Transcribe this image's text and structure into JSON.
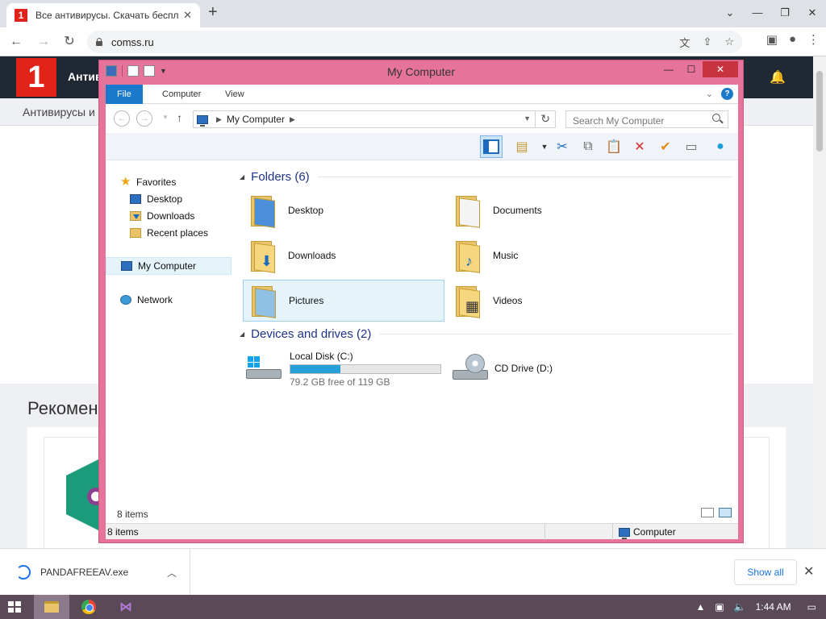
{
  "browser": {
    "tab_title": "Все антивирусы. Скачать бесплатно",
    "tab_favicon": "1",
    "url": "comss.ru"
  },
  "site": {
    "logo": "1",
    "menu_label": "Антив",
    "sub_label": "Антивирусы и",
    "heading": "Рекомен"
  },
  "explorer": {
    "window_title": "My Computer",
    "ribbon_tabs": [
      "File",
      "Computer",
      "View"
    ],
    "breadcrumb": "My Computer",
    "search_placeholder": "Search My Computer",
    "nav": {
      "favorites": "Favorites",
      "desktop": "Desktop",
      "downloads": "Downloads",
      "recent": "Recent places",
      "my_computer": "My Computer",
      "network": "Network"
    },
    "folders_heading": "Folders (6)",
    "folders": [
      "Desktop",
      "Documents",
      "Downloads",
      "Music",
      "Pictures",
      "Videos"
    ],
    "drives_heading": "Devices and drives (2)",
    "local_disk": {
      "name": "Local Disk (C:)",
      "free_text": "79.2 GB free of 119 GB",
      "used_fraction": 0.334
    },
    "cd_drive": "CD Drive (D:)",
    "items_count": "8 items",
    "status_items": "8 items",
    "status_location": "Computer"
  },
  "downloads": {
    "file": "PANDAFREEAV.exe",
    "show_all": "Show all"
  },
  "taskbar": {
    "time": "1:44 AM"
  },
  "colors": {
    "window_frame": "#e5739a",
    "accent": "#1979ca",
    "close_button": "#c7343f",
    "site_header": "#1f2833",
    "brand_red": "#e2231a"
  }
}
